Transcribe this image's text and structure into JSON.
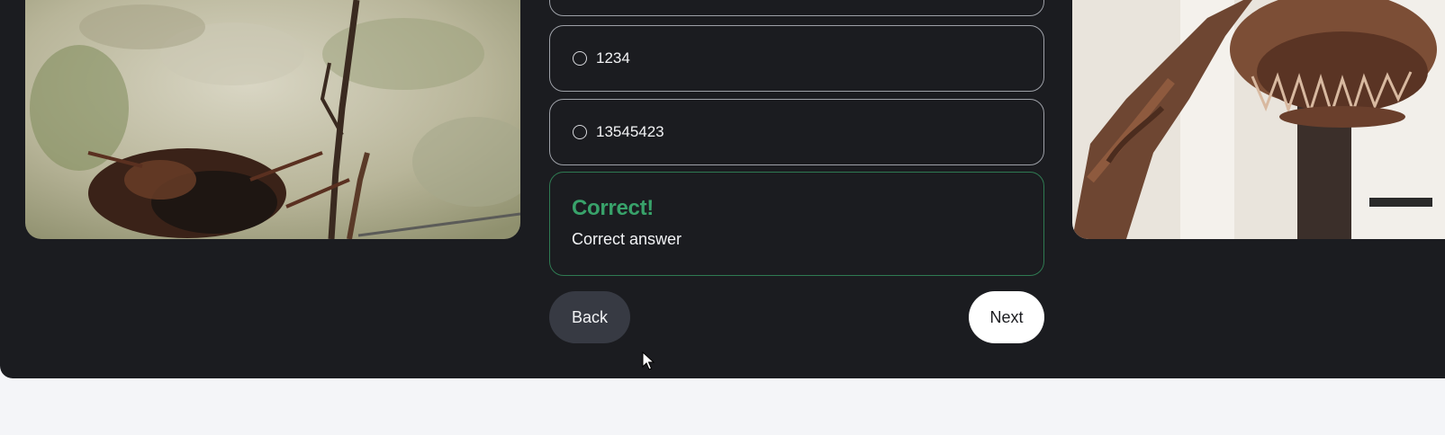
{
  "quiz": {
    "options": [
      {
        "label": ""
      },
      {
        "label": "1234"
      },
      {
        "label": "13545423"
      }
    ],
    "feedback": {
      "title": "Correct!",
      "text": "Correct answer",
      "color": "#38a26a"
    },
    "buttons": {
      "back_label": "Back",
      "next_label": "Next"
    }
  },
  "images": {
    "left": "lichen-bark-with-beetle-photo",
    "right": "dinosaur-skeleton-museum-photo"
  },
  "colors": {
    "panel_background": "#1b1c20",
    "page_background": "#f4f5f8",
    "correct_accent": "#38a26a"
  }
}
